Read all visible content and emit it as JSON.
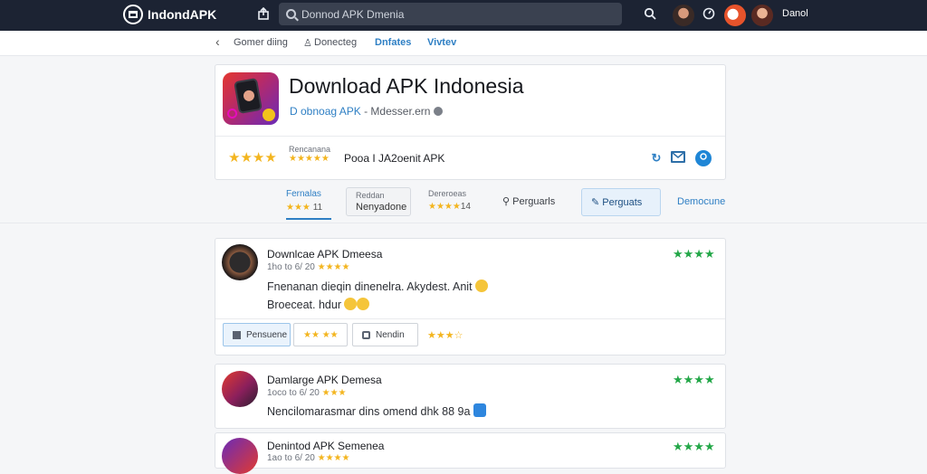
{
  "topbar": {
    "brand": "IndondAPK",
    "search_placeholder": "Donnod APK Dmenia",
    "user": "Danol",
    "icons": [
      "app-logo-icon",
      "share-icon",
      "search-icon",
      "search-action-icon",
      "compass-icon"
    ]
  },
  "subnav": {
    "back": "Gomer diing",
    "item2": "Donecteg",
    "item3": "Dnfates",
    "item4": "Vivtev"
  },
  "app": {
    "title": "Download APK Indonesia",
    "developer": "D obnoag APK",
    "separator": "-",
    "domain": "Mdesser.ern",
    "rating_stars": "★★★★",
    "rating_label": "Rencanana",
    "rating_stars2": "★★★★★",
    "rating_text": "Pooa I JA2oenit APK"
  },
  "tabs": [
    {
      "label": "Fernalas",
      "stars": "★★★ ",
      "count": "11"
    },
    {
      "label": "Reddan",
      "value": "Nenyadone"
    },
    {
      "label": "Dereroeas",
      "stars": "★★★★",
      "count": "14"
    },
    {
      "label": "Perguarls"
    },
    {
      "label": "Perguats"
    },
    {
      "label": "Democune"
    }
  ],
  "reviews": [
    {
      "name": "Downlcae APK Dmeesa",
      "date": "1ho to 6/ 20",
      "stars": "★★★★",
      "rating": "★★★★",
      "text": "Fnenanan dieqin dinenelra. Akydest. Anit",
      "text2": "Broeceat. hdur",
      "buttons": [
        "Pensuene",
        "★★ ★★",
        "Nendin"
      ],
      "trailing_stars": "★★★☆"
    },
    {
      "name": "Damlarge APK Demesa",
      "date": "1oco to 6/ 20",
      "stars": "★★★",
      "rating": "★★★★",
      "text": "Nencilomarasmar dins omend dhk 88 9a"
    },
    {
      "name": "Denintod APK Semenea",
      "date": "1ao to 6/ 20",
      "stars": "★★★★",
      "rating": "★★★★"
    }
  ],
  "colors": {
    "topbar": "#1c2333",
    "accent": "#2e7fc4",
    "star": "#f3b51f",
    "green_star": "#23a748"
  }
}
